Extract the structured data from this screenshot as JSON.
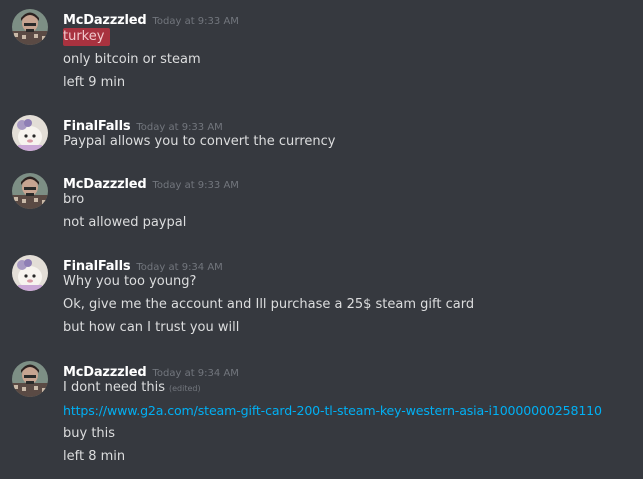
{
  "colors": {
    "background": "#36393f",
    "username": "#ffffff",
    "text": "#dcddde",
    "timestamp": "#72767d",
    "link": "#00b0f4",
    "highlight": "#a8323f"
  },
  "messages": [
    {
      "author": "McDazzzled",
      "timestamp": "Today at 9:33 AM",
      "lines": [
        "turkey",
        "only bitcoin or steam",
        "left 9 min"
      ]
    },
    {
      "author": "FinalFalls",
      "timestamp": "Today at 9:33 AM",
      "lines": [
        "Paypal allows you to convert the currency"
      ]
    },
    {
      "author": "McDazzzled",
      "timestamp": "Today at 9:33 AM",
      "lines": [
        "bro",
        "not allowed paypal"
      ]
    },
    {
      "author": "FinalFalls",
      "timestamp": "Today at 9:34 AM",
      "lines": [
        "Why you too young?",
        "Ok, give me the account and Ill purchase a 25$ steam gift card",
        "but how can I trust you will"
      ]
    },
    {
      "author": "McDazzzled",
      "timestamp": "Today at 9:34 AM",
      "lines": [
        "I dont need this",
        "https://www.g2a.com/steam-gift-card-200-tl-steam-key-western-asia-i10000000258110",
        "buy this",
        "left 8 min"
      ],
      "edited_label": "(edited)"
    }
  ]
}
